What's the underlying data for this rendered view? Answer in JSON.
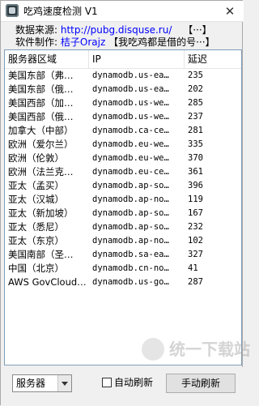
{
  "window": {
    "title": "吃鸡速度检测 V1",
    "close_glyph": "✕"
  },
  "info": {
    "source_label": "数据来源:",
    "source_link": "http://pubg.disquse.ru/",
    "source_more": "【···】",
    "author_label": "软件制作:",
    "author_name": "桔子Orajz",
    "author_tagline": "【我吃鸡都是借的号···】"
  },
  "table": {
    "columns": [
      "服务器区域",
      "IP",
      "延迟"
    ],
    "rows": [
      [
        "美国东部（弗…",
        "dynamodb.us-ea…",
        "235"
      ],
      [
        "美国东部（俄…",
        "dynamodb.us-ea…",
        "202"
      ],
      [
        "美国西部（加…",
        "dynamodb.us-we…",
        "285"
      ],
      [
        "美国西部（俄…",
        "dynamodb.us-we…",
        "237"
      ],
      [
        "加拿大（中部）",
        "dynamodb.ca-ce…",
        "281"
      ],
      [
        "欧洲（爱尔兰）",
        "dynamodb.eu-we…",
        "335"
      ],
      [
        "欧洲（伦敦）",
        "dynamodb.eu-we…",
        "370"
      ],
      [
        "欧洲（法兰克…",
        "dynamodb.eu-ce…",
        "361"
      ],
      [
        "亚太（孟买）",
        "dynamodb.ap-so…",
        "396"
      ],
      [
        "亚太（汉城）",
        "dynamodb.ap-no…",
        "119"
      ],
      [
        "亚太（新加坡）",
        "dynamodb.ap-so…",
        "167"
      ],
      [
        "亚太（悉尼）",
        "dynamodb.ap-so…",
        "232"
      ],
      [
        "亚太（东京）",
        "dynamodb.ap-no…",
        "102"
      ],
      [
        "美国南部（圣…",
        "dynamodb.sa-ea…",
        "327"
      ],
      [
        "中国（北京）",
        "dynamodb.cn-no…",
        "41"
      ],
      [
        "AWS GovCloud…",
        "dynamodb.us-go…",
        "287"
      ]
    ]
  },
  "controls": {
    "dropdown_value": "服务器",
    "auto_refresh_label": "自动刷新",
    "auto_refresh_checked": false,
    "manual_refresh_label": "手动刷新"
  },
  "watermark": {
    "text": "统一下载站"
  }
}
